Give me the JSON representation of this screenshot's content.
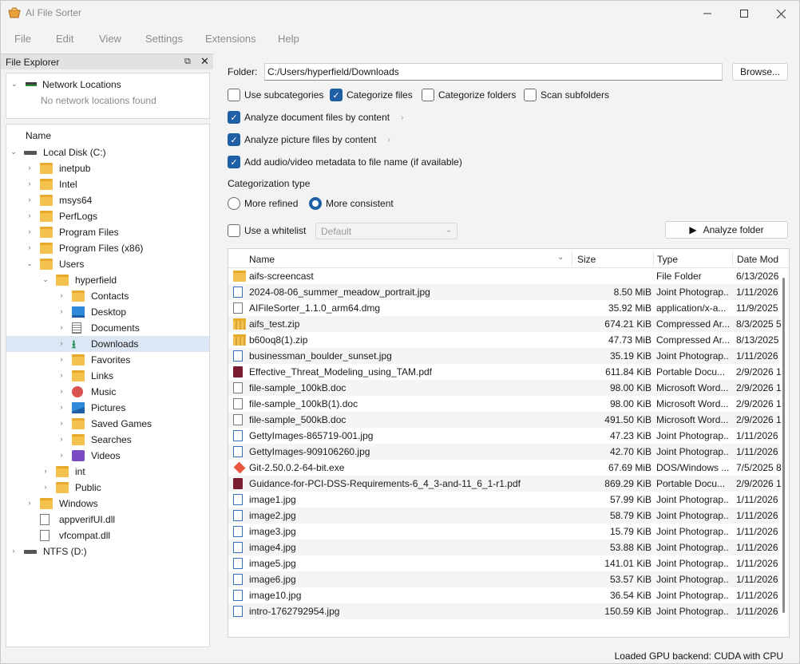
{
  "window": {
    "title": "AI File Sorter"
  },
  "menu": [
    "File",
    "Edit",
    "View",
    "Settings",
    "Extensions",
    "Help"
  ],
  "explorer": {
    "title": "File Explorer",
    "network_label": "Network Locations",
    "network_empty": "No network locations found",
    "header": "Name",
    "tree": [
      {
        "label": "Local Disk (C:)",
        "indent": 0,
        "arrow": "v",
        "icon": "drive"
      },
      {
        "label": "inetpub",
        "indent": 1,
        "arrow": ">",
        "icon": "folder"
      },
      {
        "label": "Intel",
        "indent": 1,
        "arrow": ">",
        "icon": "folder"
      },
      {
        "label": "msys64",
        "indent": 1,
        "arrow": ">",
        "icon": "folder"
      },
      {
        "label": "PerfLogs",
        "indent": 1,
        "arrow": ">",
        "icon": "folder"
      },
      {
        "label": "Program Files",
        "indent": 1,
        "arrow": ">",
        "icon": "folder"
      },
      {
        "label": "Program Files (x86)",
        "indent": 1,
        "arrow": ">",
        "icon": "folder"
      },
      {
        "label": "Users",
        "indent": 1,
        "arrow": "v",
        "icon": "folder"
      },
      {
        "label": "hyperfield",
        "indent": 2,
        "arrow": "v",
        "icon": "folder"
      },
      {
        "label": "Contacts",
        "indent": 3,
        "arrow": ">",
        "icon": "folder"
      },
      {
        "label": "Desktop",
        "indent": 3,
        "arrow": ">",
        "icon": "desktop"
      },
      {
        "label": "Documents",
        "indent": 3,
        "arrow": ">",
        "icon": "documents"
      },
      {
        "label": "Downloads",
        "indent": 3,
        "arrow": ">",
        "icon": "download",
        "selected": true
      },
      {
        "label": "Favorites",
        "indent": 3,
        "arrow": ">",
        "icon": "folder"
      },
      {
        "label": "Links",
        "indent": 3,
        "arrow": ">",
        "icon": "folder"
      },
      {
        "label": "Music",
        "indent": 3,
        "arrow": ">",
        "icon": "music"
      },
      {
        "label": "Pictures",
        "indent": 3,
        "arrow": ">",
        "icon": "pictures"
      },
      {
        "label": "Saved Games",
        "indent": 3,
        "arrow": ">",
        "icon": "folder"
      },
      {
        "label": "Searches",
        "indent": 3,
        "arrow": ">",
        "icon": "folder"
      },
      {
        "label": "Videos",
        "indent": 3,
        "arrow": ">",
        "icon": "videos"
      },
      {
        "label": "int",
        "indent": 2,
        "arrow": ">",
        "icon": "folder"
      },
      {
        "label": "Public",
        "indent": 2,
        "arrow": ">",
        "icon": "folder"
      },
      {
        "label": "Windows",
        "indent": 1,
        "arrow": ">",
        "icon": "folder"
      },
      {
        "label": "appverifUI.dll",
        "indent": 1,
        "arrow": "",
        "icon": "file"
      },
      {
        "label": "vfcompat.dll",
        "indent": 1,
        "arrow": "",
        "icon": "file"
      },
      {
        "label": "NTFS (D:)",
        "indent": 0,
        "arrow": ">",
        "icon": "drive"
      }
    ]
  },
  "form": {
    "folder_label": "Folder:",
    "folder_value": "C:/Users/hyperfield/Downloads",
    "browse_label": "Browse...",
    "use_subcategories": "Use subcategories",
    "categorize_files": "Categorize files",
    "categorize_folders": "Categorize folders",
    "scan_subfolders": "Scan subfolders",
    "analyze_docs": "Analyze document files by content",
    "analyze_pictures": "Analyze picture files by content",
    "add_metadata": "Add audio/video metadata to file name (if available)",
    "categorization_type": "Categorization type",
    "more_refined": "More refined",
    "more_consistent": "More consistent",
    "use_whitelist": "Use a whitelist",
    "whitelist_value": "Default",
    "analyze_label": "Analyze folder",
    "checked": {
      "use_subcategories": false,
      "categorize_files": true,
      "categorize_folders": false,
      "scan_subfolders": false,
      "analyze_docs": true,
      "analyze_pictures": true,
      "add_metadata": true,
      "use_whitelist": false
    },
    "radio_selected": "more_consistent"
  },
  "table": {
    "headers": {
      "name": "Name",
      "size": "Size",
      "type": "Type",
      "date": "Date Mod"
    },
    "rows": [
      {
        "name": "aifs-screencast",
        "size": "",
        "type": "File Folder",
        "date": "6/13/2026",
        "icon": "folder"
      },
      {
        "name": "2024-08-06_summer_meadow_portrait.jpg",
        "size": "8.50 MiB",
        "type": "Joint Photograp...",
        "date": "1/11/2026",
        "icon": "doc"
      },
      {
        "name": "AIFileSorter_1.1.0_arm64.dmg",
        "size": "35.92 MiB",
        "type": "application/x-a...",
        "date": "11/9/2025",
        "icon": "file"
      },
      {
        "name": "aifs_test.zip",
        "size": "674.21 KiB",
        "type": "Compressed Ar...",
        "date": "8/3/2025 5",
        "icon": "zip"
      },
      {
        "name": "b60oq8(1).zip",
        "size": "47.73 MiB",
        "type": "Compressed Ar...",
        "date": "8/13/2025",
        "icon": "zip"
      },
      {
        "name": "businessman_boulder_sunset.jpg",
        "size": "35.19 KiB",
        "type": "Joint Photograp...",
        "date": "1/11/2026",
        "icon": "doc"
      },
      {
        "name": "Effective_Threat_Modeling_using_TAM.pdf",
        "size": "611.84 KiB",
        "type": "Portable Docu...",
        "date": "2/9/2026 1",
        "icon": "pdf"
      },
      {
        "name": "file-sample_100kB.doc",
        "size": "98.00 KiB",
        "type": "Microsoft Word...",
        "date": "2/9/2026 1",
        "icon": "file"
      },
      {
        "name": "file-sample_100kB(1).doc",
        "size": "98.00 KiB",
        "type": "Microsoft Word...",
        "date": "2/9/2026 1",
        "icon": "file"
      },
      {
        "name": "file-sample_500kB.doc",
        "size": "491.50 KiB",
        "type": "Microsoft Word...",
        "date": "2/9/2026 1",
        "icon": "file"
      },
      {
        "name": "GettyImages-865719-001.jpg",
        "size": "47.23 KiB",
        "type": "Joint Photograp...",
        "date": "1/11/2026",
        "icon": "doc"
      },
      {
        "name": "GettyImages-909106260.jpg",
        "size": "42.70 KiB",
        "type": "Joint Photograp...",
        "date": "1/11/2026",
        "icon": "doc"
      },
      {
        "name": "Git-2.50.0.2-64-bit.exe",
        "size": "67.69 MiB",
        "type": "DOS/Windows ...",
        "date": "7/5/2025 8",
        "icon": "git"
      },
      {
        "name": "Guidance-for-PCI-DSS-Requirements-6_4_3-and-11_6_1-r1.pdf",
        "size": "869.29 KiB",
        "type": "Portable Docu...",
        "date": "2/9/2026 1",
        "icon": "pdf"
      },
      {
        "name": "image1.jpg",
        "size": "57.99 KiB",
        "type": "Joint Photograp...",
        "date": "1/11/2026",
        "icon": "doc"
      },
      {
        "name": "image2.jpg",
        "size": "58.79 KiB",
        "type": "Joint Photograp...",
        "date": "1/11/2026",
        "icon": "doc"
      },
      {
        "name": "image3.jpg",
        "size": "15.79 KiB",
        "type": "Joint Photograp...",
        "date": "1/11/2026",
        "icon": "doc"
      },
      {
        "name": "image4.jpg",
        "size": "53.88 KiB",
        "type": "Joint Photograp...",
        "date": "1/11/2026",
        "icon": "doc"
      },
      {
        "name": "image5.jpg",
        "size": "141.01 KiB",
        "type": "Joint Photograp...",
        "date": "1/11/2026",
        "icon": "doc"
      },
      {
        "name": "image6.jpg",
        "size": "53.57 KiB",
        "type": "Joint Photograp...",
        "date": "1/11/2026",
        "icon": "doc"
      },
      {
        "name": "image10.jpg",
        "size": "36.54 KiB",
        "type": "Joint Photograp...",
        "date": "1/11/2026",
        "icon": "doc"
      },
      {
        "name": "intro-1762792954.jpg",
        "size": "150.59 KiB",
        "type": "Joint Photograp...",
        "date": "1/11/2026",
        "icon": "doc"
      }
    ]
  },
  "status": "Loaded GPU backend: CUDA with CPU",
  "colors": {
    "accent": "#1f5fa6",
    "selection": "#dce7f5",
    "folder": "#f2c14e"
  }
}
